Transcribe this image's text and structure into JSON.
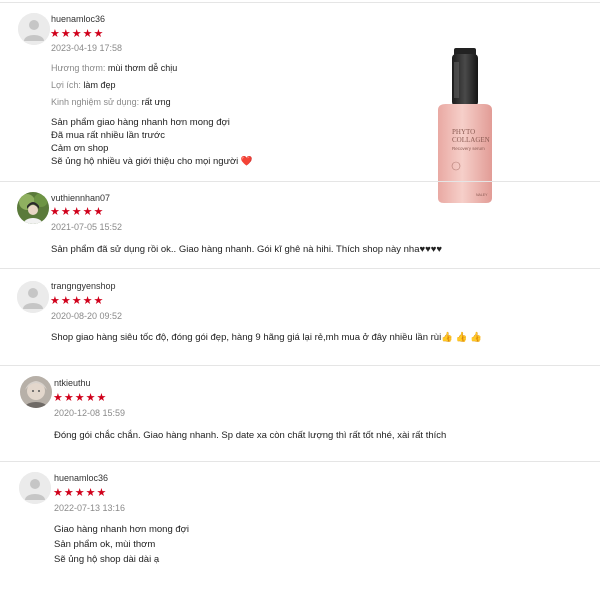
{
  "reviews": [
    {
      "username": "huenamloc36",
      "stars": "★★★★★",
      "date": "2023-04-19 17:58",
      "attributes": [
        {
          "label": "Hương thơm:",
          "value": "mùi thơm dễ chịu"
        },
        {
          "label": "Lợi ích:",
          "value": "làm đẹp"
        },
        {
          "label": "Kinh nghiệm sử dụng:",
          "value": "rất ưng"
        }
      ],
      "lines": [
        "Sản phẩm giao hàng nhanh hơn mong đợi",
        "Đã mua rất nhiều lần trước",
        "Cảm ơn shop",
        "Sẽ ủng hộ nhiều và giới thiệu cho mọi người ❤️"
      ],
      "product_image": {
        "brand": "PHYTO COLLAGEN",
        "subtitle": "Recovery serum",
        "maker": "NALEY"
      }
    },
    {
      "username": "vuthiennhan07",
      "stars": "★★★★★",
      "date": "2021-07-05 15:52",
      "lines": [
        "Sản phẩm đã sử dụng rồi ok.. Giao hàng nhanh. Gói kĩ ghê nà hihi. Thích shop này nha♥♥♥♥"
      ]
    },
    {
      "username": "trangngyenshop",
      "stars": "★★★★★",
      "date": "2020-08-20 09:52",
      "lines": [
        "Shop giao hàng siêu tốc độ, đóng gói đẹp, hàng 9 hãng giá lại rẻ,mh mua ở đây nhiều lần rùi👍 👍 👍"
      ]
    },
    {
      "username": "ntkieuthu",
      "stars": "★★★★★",
      "date": "2020-12-08 15:59",
      "lines": [
        "Đóng gói chắc chắn. Giao hàng nhanh. Sp date xa còn chất lượng thì rất tốt nhé, xài rất thích"
      ]
    },
    {
      "username": "huenamloc36",
      "stars": "★★★★★",
      "date": "2022-07-13 13:16",
      "lines": [
        "Giao hàng nhanh hơn mong đợi",
        "Sản phẩm ok, mùi thơm",
        "Sẽ ủng hộ shop dài dài ạ"
      ]
    }
  ],
  "colors": {
    "star": "#d0011b",
    "muted": "#8a8a8a",
    "divider": "#e5e5e5"
  },
  "icons": {
    "default_avatar": "user-silhouette-icon"
  }
}
